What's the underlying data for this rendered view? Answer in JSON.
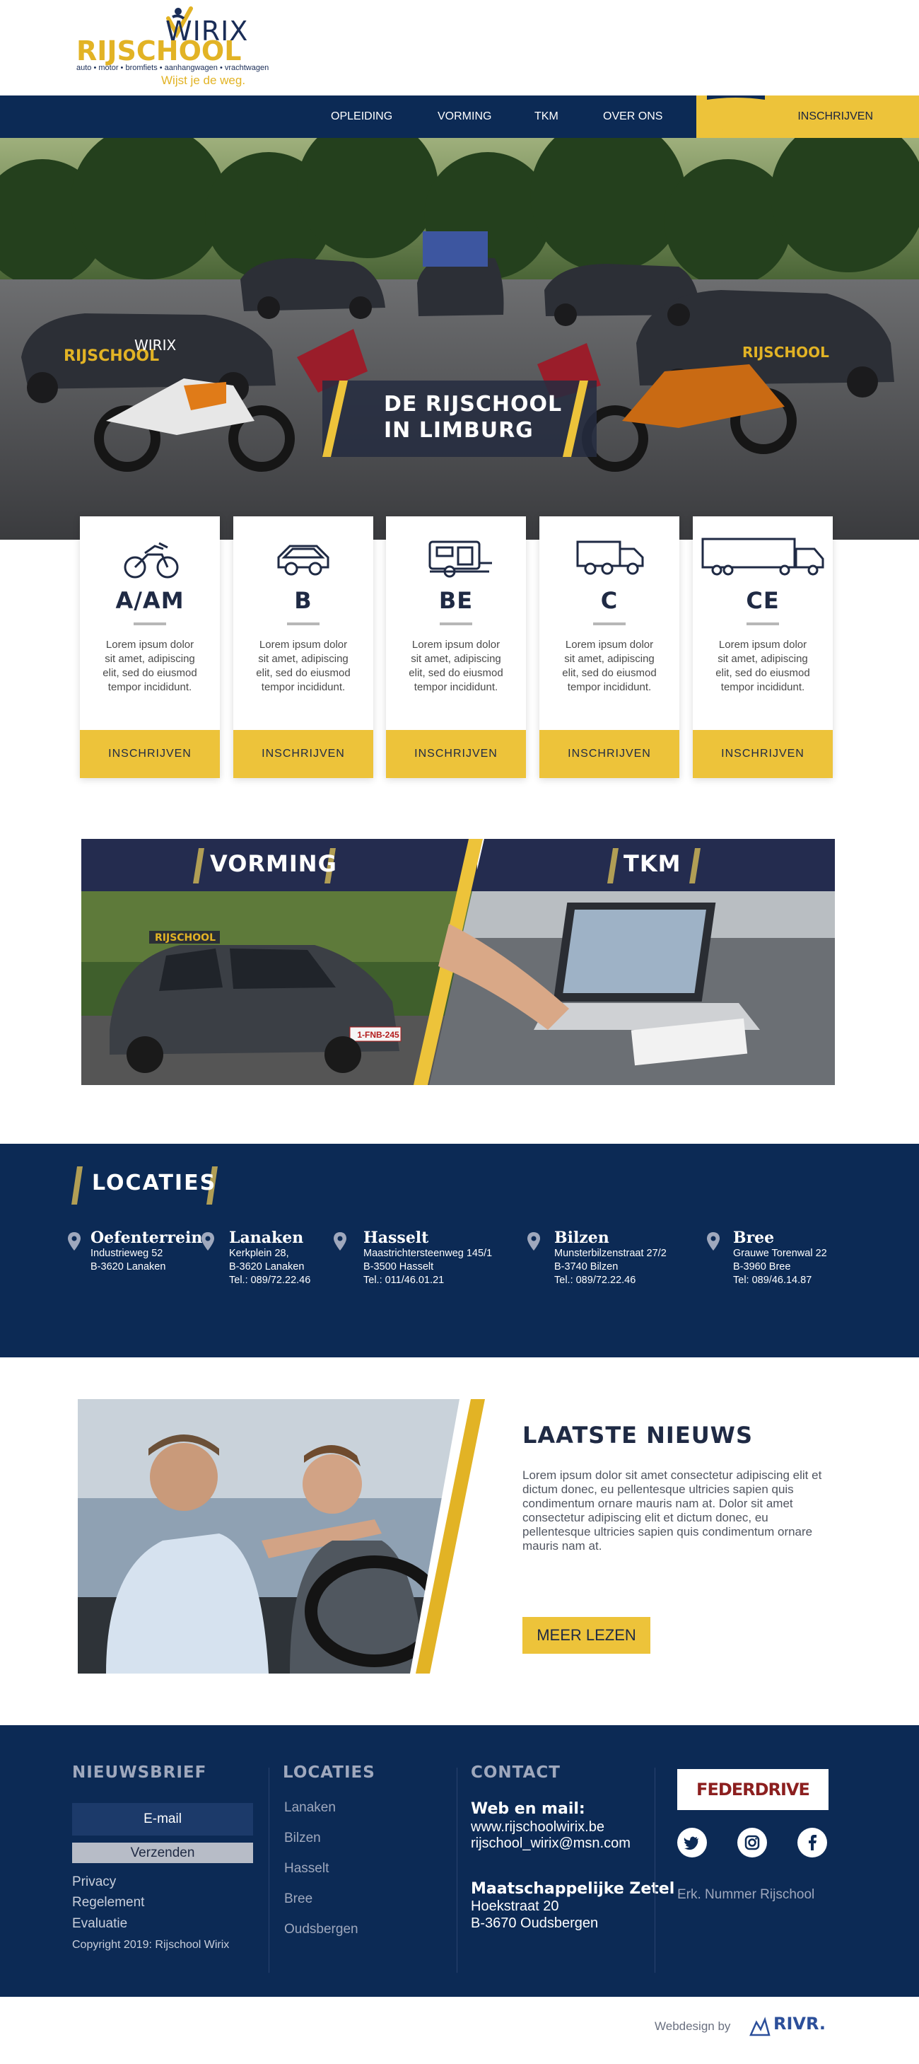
{
  "header": {
    "logo_brand": "WIRIX",
    "logo_school": "RIJSCHOOL",
    "logo_sub": "auto • motor • bromfiets • aanhangwagen • vrachtwagen",
    "logo_slogan": "Wijst je de weg."
  },
  "nav": {
    "items": [
      "OPLEIDING",
      "VORMING",
      "TKM",
      "OVER ONS"
    ],
    "cta": "INSCHRIJVEN"
  },
  "hero": {
    "title_line1": "DE RIJSCHOOL",
    "title_line2": "IN LIMBURG"
  },
  "cards": [
    {
      "code": "A/AM",
      "icon": "motorcycle-icon",
      "text": "Lorem ipsum dolor sit amet, adipiscing elit, sed do eiusmod tempor incididunt.",
      "button": "INSCHRIJVEN"
    },
    {
      "code": "B",
      "icon": "car-icon",
      "text": "Lorem ipsum dolor sit amet, adipiscing elit, sed do eiusmod tempor incididunt.",
      "button": "INSCHRIJVEN"
    },
    {
      "code": "BE",
      "icon": "caravan-icon",
      "text": "Lorem ipsum dolor sit amet, adipiscing elit, sed do eiusmod tempor incididunt.",
      "button": "INSCHRIJVEN"
    },
    {
      "code": "C",
      "icon": "truck-icon",
      "text": "Lorem ipsum dolor sit amet, adipiscing elit, sed do eiusmod tempor incididunt.",
      "button": "INSCHRIJVEN"
    },
    {
      "code": "CE",
      "icon": "semi-truck-icon",
      "text": "Lorem ipsum dolor sit amet, adipiscing elit, sed do eiusmod tempor incididunt.",
      "button": "INSCHRIJVEN"
    }
  ],
  "panels": {
    "vorming": "VORMING",
    "tkm": "TKM",
    "plate": "1-FNB-245"
  },
  "locaties": {
    "title": "LOCATIES",
    "items": [
      {
        "name": "Oefenterrein",
        "line1": "Industrieweg 52",
        "line2": "B-3620 Lanaken",
        "line3": ""
      },
      {
        "name": "Lanaken",
        "line1": "Kerkplein 28,",
        "line2": "B-3620 Lanaken",
        "line3": "Tel.: 089/72.22.46"
      },
      {
        "name": "Hasselt",
        "line1": "Maastrichtersteenweg 145/1",
        "line2": "B-3500 Hasselt",
        "line3": "Tel.: 011/46.01.21"
      },
      {
        "name": "Bilzen",
        "line1": "Munsterbilzenstraat 27/2",
        "line2": "B-3740 Bilzen",
        "line3": "Tel.: 089/72.22.46"
      },
      {
        "name": "Bree",
        "line1": "Grauwe Torenwal 22",
        "line2": "B-3960 Bree",
        "line3": "Tel: 089/46.14.87"
      }
    ]
  },
  "news": {
    "title": "LAATSTE NIEUWS",
    "body": "Lorem ipsum dolor sit amet consectetur adipiscing elit et dictum donec, eu pellentesque ultricies sapien quis condimentum ornare mauris nam at. Dolor sit amet consectetur adipiscing elit et dictum donec, eu pellentesque ultricies sapien quis condimentum ornare mauris nam at.",
    "button": "MEER LEZEN"
  },
  "footer": {
    "newsletter_title": "NIEUWSBRIEF",
    "email_placeholder": "E-mail",
    "send": "Verzenden",
    "privacy": "Privacy",
    "reglement": "Regelement",
    "evaluatie": "Evaluatie",
    "copyright": "Copyright 2019: Rijschool Wirix",
    "locaties_title": "LOCATIES",
    "locaties": [
      "Lanaken",
      "Bilzen",
      "Hasselt",
      "Bree",
      "Oudsbergen"
    ],
    "contact_title": "CONTACT",
    "web_label": "Web en mail:",
    "web": "www.rijschoolwirix.be",
    "mail": "rijschool_wirix@msn.com",
    "zetel_label": "Maatschappelijke Zetel",
    "zetel_line1": "Hoekstraat 20",
    "zetel_line2": "B-3670 Oudsbergen",
    "federdrive": "FEDERDRIVE",
    "socials": [
      "twitter-icon",
      "instagram-icon",
      "facebook-icon"
    ],
    "erk": "Erk. Nummer Rijschool"
  },
  "credit": {
    "label": "Webdesign by",
    "brand": "RIVR."
  },
  "colors": {
    "navy": "#0c2a55",
    "yellow": "#edc33a",
    "dark": "#1f2a44"
  }
}
